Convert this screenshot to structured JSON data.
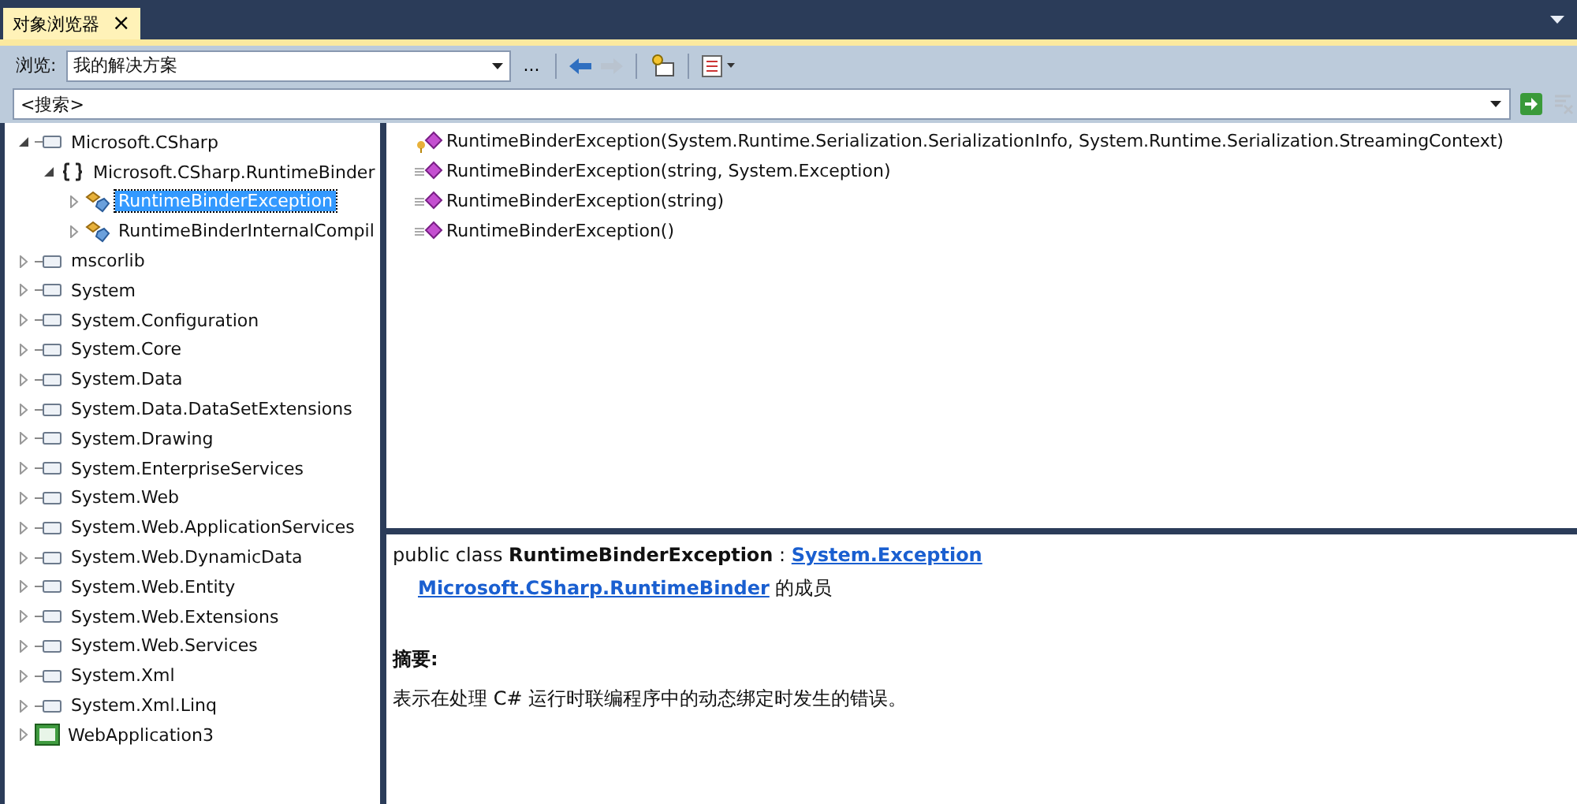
{
  "tabs": [
    {
      "label": "对象浏览器",
      "selected": true,
      "close": "×"
    }
  ],
  "toolbar": {
    "browse_label": "浏览:",
    "browse_value": "我的解决方案",
    "more": "..."
  },
  "search": {
    "placeholder": "<搜索>"
  },
  "tree": [
    {
      "label": "Microsoft.CSharp",
      "kind": "assembly",
      "expanded": true,
      "selected": false,
      "children": [
        {
          "label": "Microsoft.CSharp.RuntimeBinder",
          "kind": "namespace",
          "expanded": true,
          "selected": false,
          "children": [
            {
              "label": "RuntimeBinderException",
              "kind": "class",
              "expanded": false,
              "selected": true
            },
            {
              "label": "RuntimeBinderInternalCompil",
              "kind": "class",
              "expanded": false,
              "selected": false
            }
          ]
        }
      ]
    },
    {
      "label": "mscorlib",
      "kind": "assembly",
      "expanded": false,
      "selected": false
    },
    {
      "label": "System",
      "kind": "assembly",
      "expanded": false,
      "selected": false
    },
    {
      "label": "System.Configuration",
      "kind": "assembly",
      "expanded": false,
      "selected": false
    },
    {
      "label": "System.Core",
      "kind": "assembly",
      "expanded": false,
      "selected": false
    },
    {
      "label": "System.Data",
      "kind": "assembly",
      "expanded": false,
      "selected": false
    },
    {
      "label": "System.Data.DataSetExtensions",
      "kind": "assembly",
      "expanded": false,
      "selected": false
    },
    {
      "label": "System.Drawing",
      "kind": "assembly",
      "expanded": false,
      "selected": false
    },
    {
      "label": "System.EnterpriseServices",
      "kind": "assembly",
      "expanded": false,
      "selected": false
    },
    {
      "label": "System.Web",
      "kind": "assembly",
      "expanded": false,
      "selected": false
    },
    {
      "label": "System.Web.ApplicationServices",
      "kind": "assembly",
      "expanded": false,
      "selected": false
    },
    {
      "label": "System.Web.DynamicData",
      "kind": "assembly",
      "expanded": false,
      "selected": false
    },
    {
      "label": "System.Web.Entity",
      "kind": "assembly",
      "expanded": false,
      "selected": false
    },
    {
      "label": "System.Web.Extensions",
      "kind": "assembly",
      "expanded": false,
      "selected": false
    },
    {
      "label": "System.Web.Services",
      "kind": "assembly",
      "expanded": false,
      "selected": false
    },
    {
      "label": "System.Xml",
      "kind": "assembly",
      "expanded": false,
      "selected": false
    },
    {
      "label": "System.Xml.Linq",
      "kind": "assembly",
      "expanded": false,
      "selected": false
    },
    {
      "label": "WebApplication3",
      "kind": "project",
      "expanded": false,
      "selected": false
    }
  ],
  "members": [
    {
      "label": "RuntimeBinderException(System.Runtime.Serialization.SerializationInfo, System.Runtime.Serialization.StreamingContext)",
      "kind": "protected"
    },
    {
      "label": "RuntimeBinderException(string, System.Exception)",
      "kind": "public"
    },
    {
      "label": "RuntimeBinderException(string)",
      "kind": "public"
    },
    {
      "label": "RuntimeBinderException()",
      "kind": "public"
    }
  ],
  "details": {
    "declaration": "public class **RuntimeBinderException** : ",
    "base_link": "System.Exception",
    "member_of_link": "Microsoft.CSharp.RuntimeBinder",
    "member_of_suffix": "的成员",
    "summary_heading": "摘要:",
    "summary": "表示在处理 C# 运行时联编程序中的动态绑定时发生的错误。"
  }
}
